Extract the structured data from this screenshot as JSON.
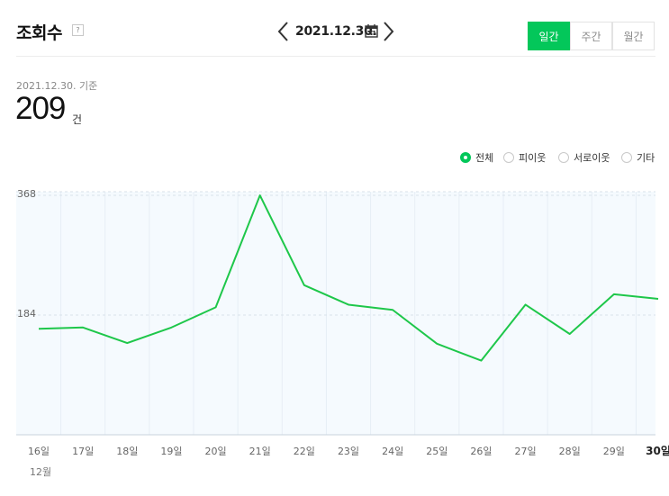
{
  "header": {
    "title": "조회수",
    "help": "?",
    "date": "2021.12.30.",
    "tabs": [
      {
        "label": "일간",
        "active": true
      },
      {
        "label": "주간",
        "active": false
      },
      {
        "label": "월간",
        "active": false
      }
    ]
  },
  "summary": {
    "basis": "2021.12.30. 기준",
    "count": "209",
    "unit": "건"
  },
  "filters": [
    {
      "label": "전체",
      "selected": true
    },
    {
      "label": "피이웃",
      "selected": false
    },
    {
      "label": "서로이웃",
      "selected": false
    },
    {
      "label": "기타",
      "selected": false
    }
  ],
  "colors": {
    "accent": "#03c75a",
    "line": "#1ec74a",
    "plot_bg": "#f5fafe"
  },
  "chart_data": {
    "type": "line",
    "categories": [
      "16일",
      "17일",
      "18일",
      "19일",
      "20일",
      "21일",
      "22일",
      "23일",
      "24일",
      "25일",
      "26일",
      "27일",
      "28일",
      "29일",
      "30일"
    ],
    "month_label": "12월",
    "series": [
      {
        "values": [
          163,
          165,
          141,
          165,
          196,
          368,
          230,
          200,
          192,
          140,
          114,
          200,
          155,
          216,
          209
        ]
      }
    ],
    "yticks": [
      184,
      368
    ],
    "ylim": [
      0,
      368
    ],
    "grid": true,
    "highlight_last_tick": true
  }
}
